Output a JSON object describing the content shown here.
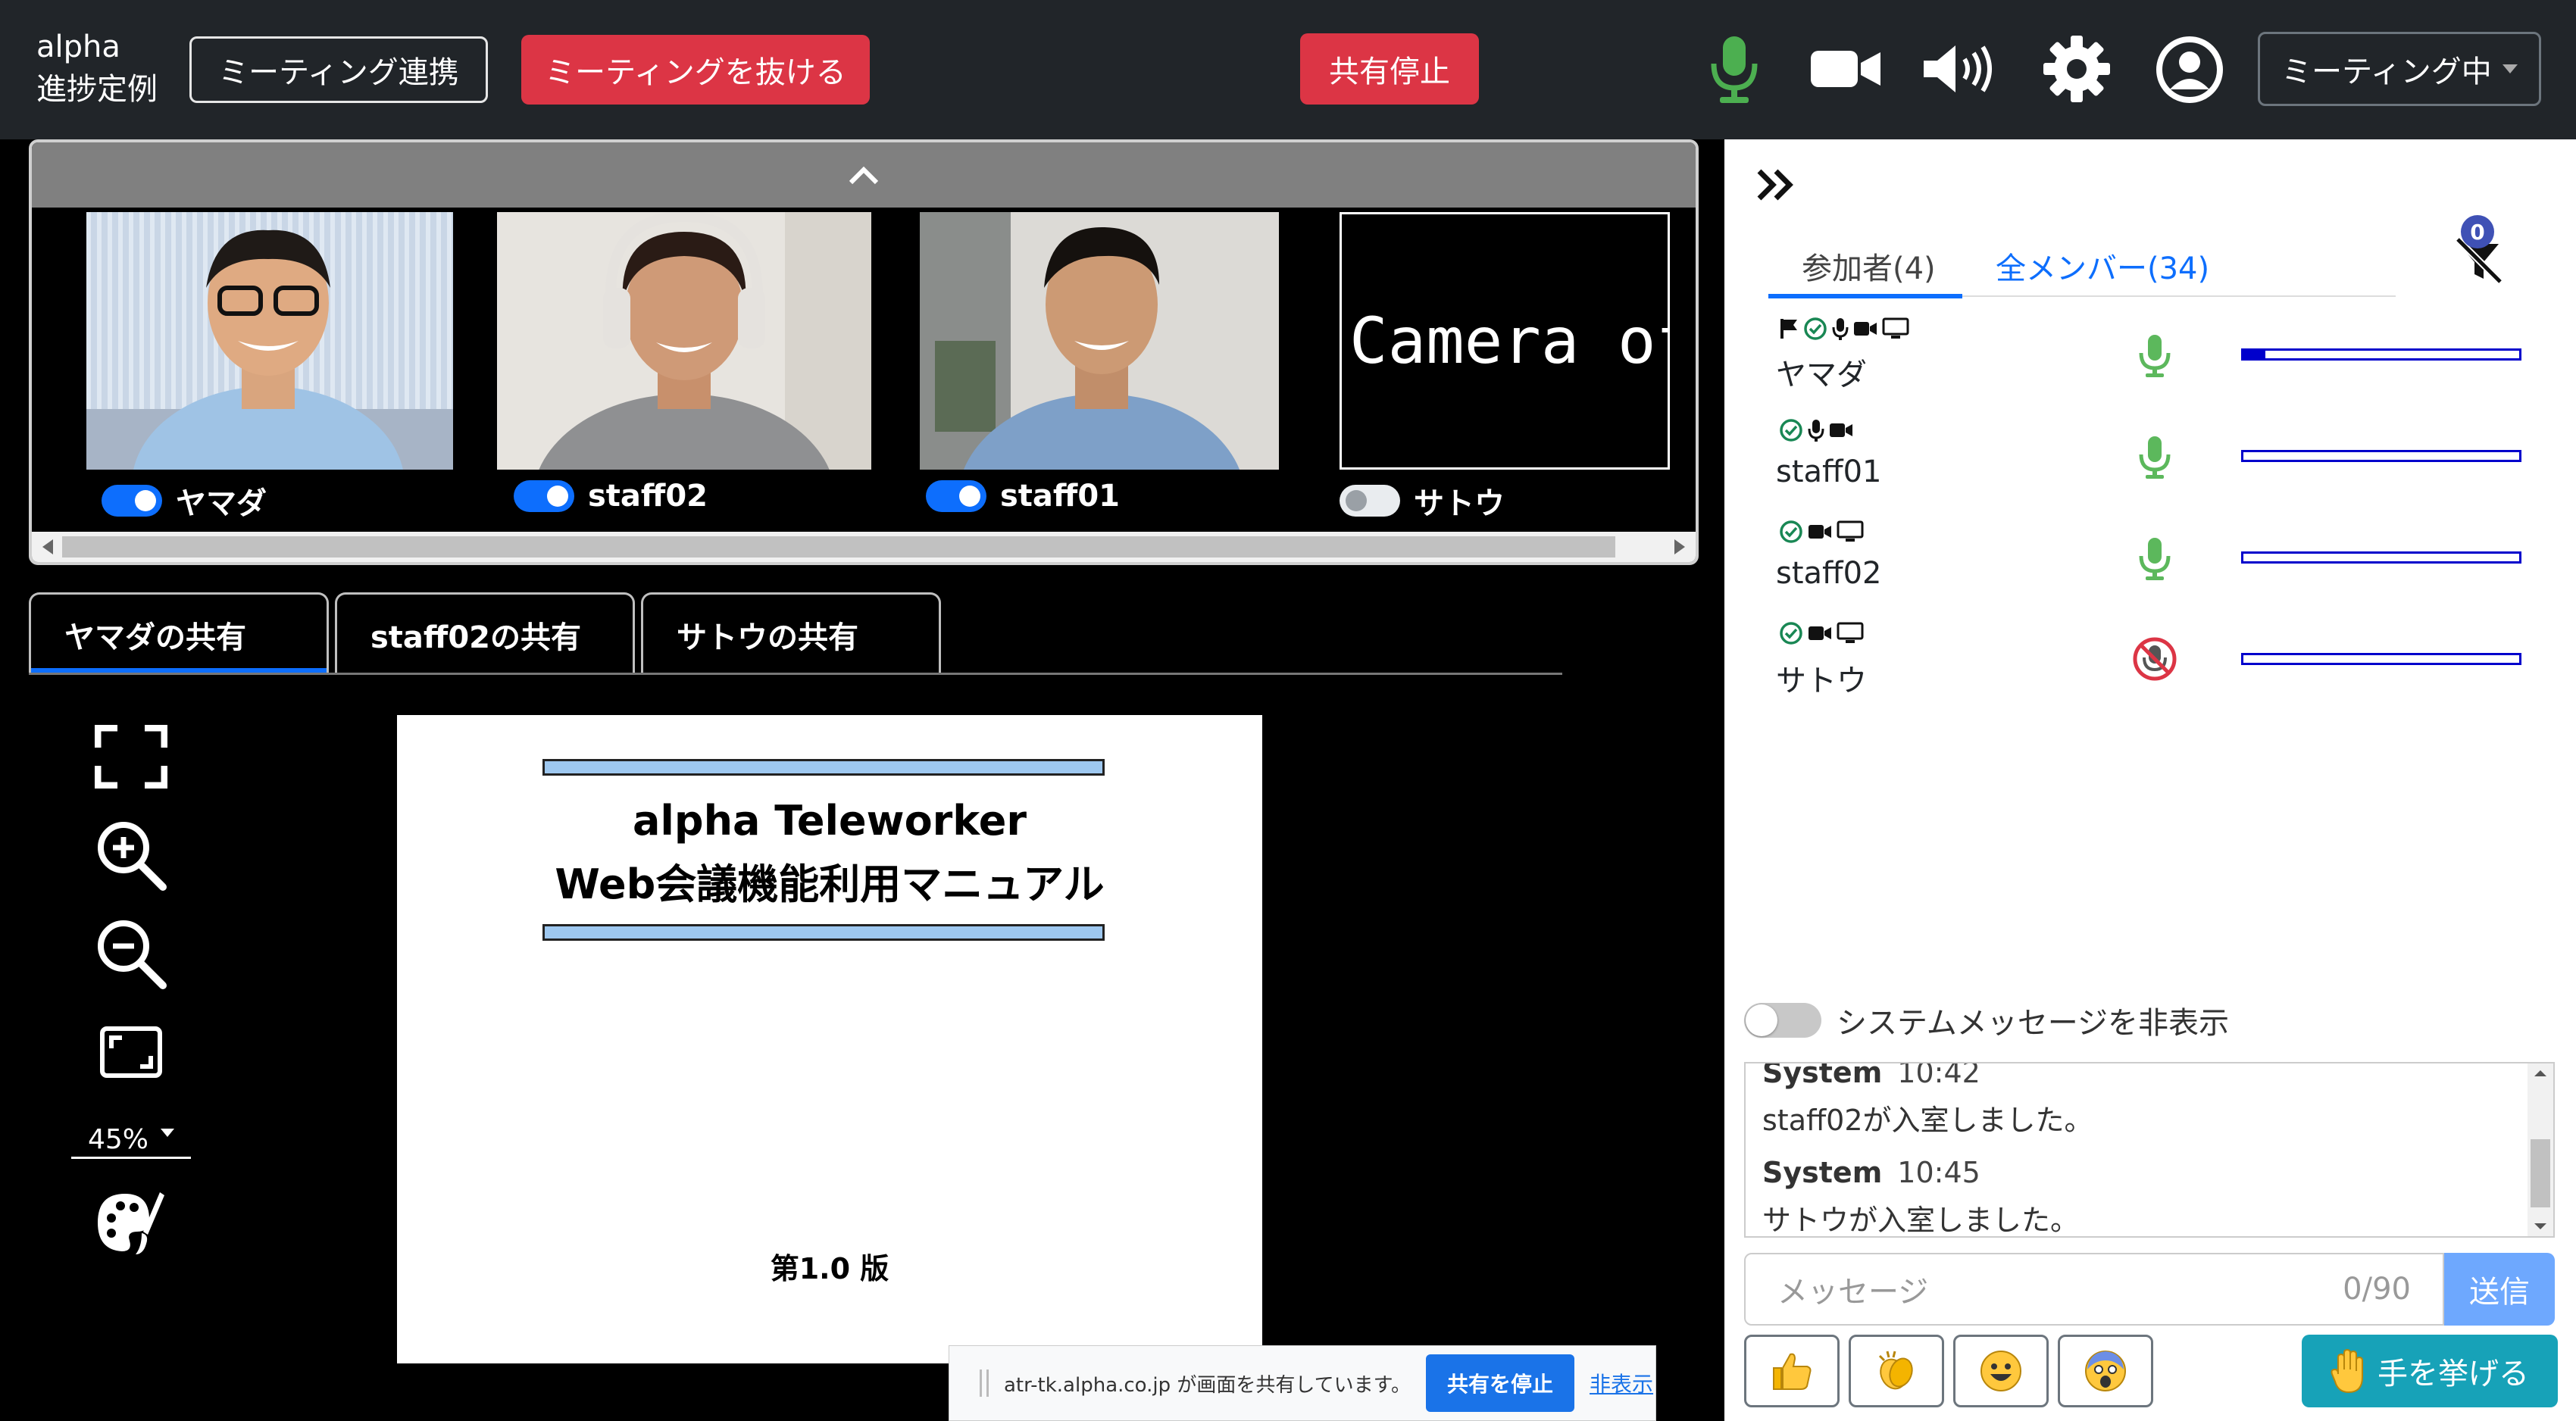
{
  "header": {
    "app_title_line1": "alpha",
    "app_title_line2": "進捗定例",
    "meeting_link_label": "ミーティング連携",
    "leave_meeting_label": "ミーティングを抜ける",
    "stop_share_label": "共有停止",
    "status_label": "ミーティング中"
  },
  "videos": [
    {
      "name": "ヤマダ",
      "camera_on": true
    },
    {
      "name": "staff02",
      "camera_on": true
    },
    {
      "name": "staff01",
      "camera_on": true
    },
    {
      "name": "サトウ",
      "camera_on": false,
      "camera_off_text": "Camera off"
    }
  ],
  "share_tabs": [
    {
      "label": "ヤマダの共有",
      "active": true
    },
    {
      "label": "staff02の共有",
      "active": false
    },
    {
      "label": "サトウの共有",
      "active": false
    }
  ],
  "tools": {
    "zoom_level": "45%"
  },
  "document": {
    "title_line1": "alpha Teleworker",
    "title_line2": "Web会議機能利用マニュアル",
    "version": "第1.0 版"
  },
  "share_notice": {
    "text": "atr-tk.alpha.co.jp が画面を共有しています。",
    "stop_label": "共有を停止",
    "hide_label": "非表示"
  },
  "sidebar": {
    "tab_participants": "参加者(4)",
    "tab_all_members": "全メンバー(34)",
    "hand_badge_count": "0",
    "participants": [
      {
        "name": "ヤマダ",
        "icons": [
          "flag",
          "check",
          "mic",
          "video",
          "screen"
        ],
        "mic_on": true,
        "audio_level": 0.08
      },
      {
        "name": "staff01",
        "icons": [
          "check",
          "mic",
          "video"
        ],
        "mic_on": true,
        "audio_level": 0
      },
      {
        "name": "staff02",
        "icons": [
          "check",
          "video",
          "screen"
        ],
        "mic_on": true,
        "audio_level": 0
      },
      {
        "name": "サトウ",
        "icons": [
          "check",
          "video",
          "screen"
        ],
        "mic_on": false,
        "audio_level": 0
      }
    ],
    "system_toggle_label": "システムメッセージを非表示",
    "messages": [
      {
        "sender": "System",
        "time": "10:42",
        "text": "staff02が入室しました。"
      },
      {
        "sender": "System",
        "time": "10:45",
        "text": "サトウが入室しました。"
      }
    ],
    "message_placeholder": "メッセージ",
    "message_counter": "0/90",
    "send_label": "送信",
    "raise_hand_label": "手を挙げる"
  },
  "colors": {
    "topbar_bg": "#212529",
    "danger": "#dc3545",
    "primary": "#0d6efd",
    "mic_green": "#4caf50",
    "info": "#17a2b8"
  }
}
